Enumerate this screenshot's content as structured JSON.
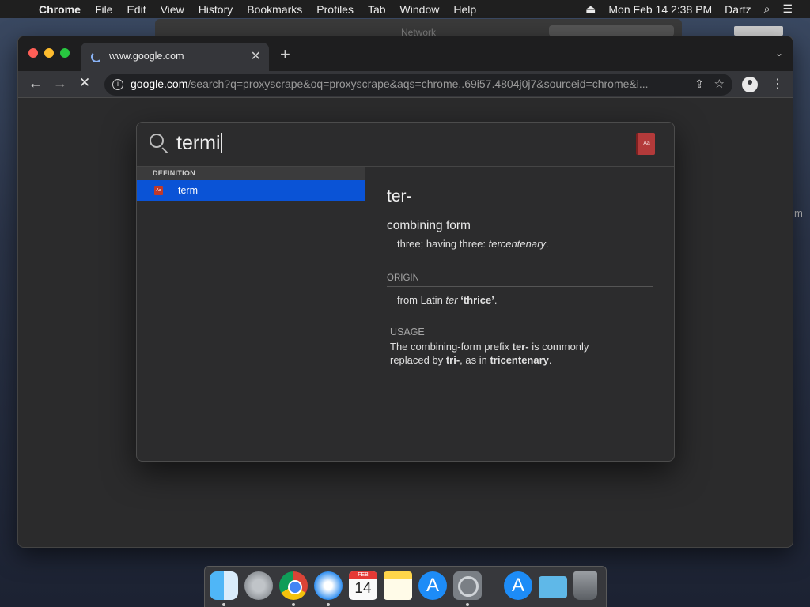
{
  "menubar": {
    "app": "Chrome",
    "items": [
      "File",
      "Edit",
      "View",
      "History",
      "Bookmarks",
      "Profiles",
      "Tab",
      "Window",
      "Help"
    ],
    "datetime": "Mon Feb 14  2:38 PM",
    "user": "Dartz"
  },
  "background_window": {
    "title": "Network"
  },
  "chrome": {
    "tab_title": "www.google.com",
    "url_host": "google.com",
    "url_path": "/search?q=proxyscrape&oq=proxyscrape&aqs=chrome..69i57.4804j0j7&sourceid=chrome&i..."
  },
  "spotlight": {
    "query": "termi",
    "section_label": "DEFINITION",
    "result_label": "term",
    "dict_icon_text": "Aa",
    "headword": "ter-",
    "part_of_speech": "combining form",
    "definition_text": "three; having three: ",
    "definition_example": "tercentenary",
    "definition_end": ".",
    "origin_heading": "ORIGIN",
    "origin_prefix": "from Latin ",
    "origin_word": "ter",
    "origin_gloss": " ‘thrice’",
    "origin_end": ".",
    "usage_heading": "USAGE",
    "usage_1": "The combining-form prefix ",
    "usage_b1": "ter-",
    "usage_2": " is commonly replaced by ",
    "usage_b2": "tri-",
    "usage_3": ", as in ",
    "usage_b3": "tricentenary",
    "usage_4": "."
  },
  "dock": {
    "calendar_month": "FEB",
    "calendar_day": "14",
    "items": [
      "Finder",
      "Launchpad",
      "Google Chrome",
      "Safari",
      "Calendar",
      "Notes",
      "App Store",
      "System Preferences",
      "App Store",
      "Downloads",
      "Trash"
    ]
  }
}
